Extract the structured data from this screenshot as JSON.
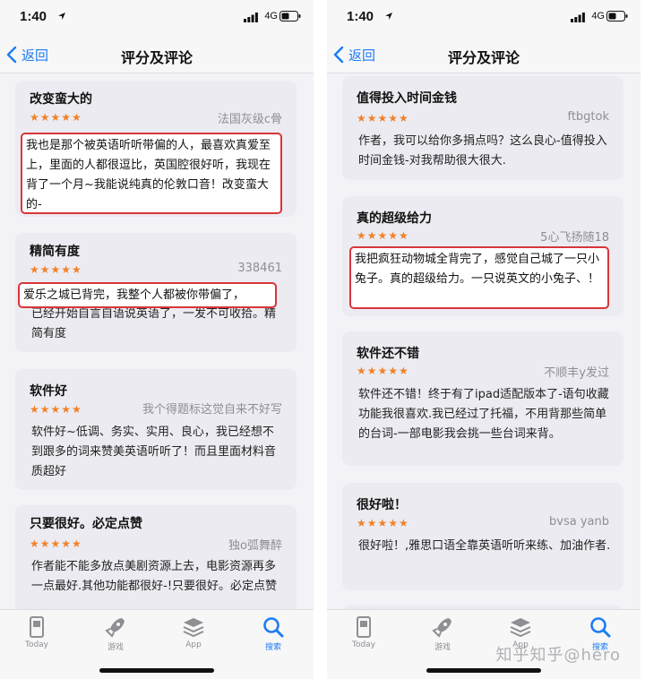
{
  "status": {
    "time": "1:40",
    "network": "4G"
  },
  "nav": {
    "back_label": "返回",
    "title": "评分及评论"
  },
  "tabs": [
    "Today",
    "游戏",
    "App",
    "搜索"
  ],
  "left_reviews": [
    {
      "title": "改变蛮大的",
      "stars": "★★★★★",
      "author": "法国灰级c骨",
      "body": "",
      "highlight": "我也是那个被英语听听带偏的人，最喜欢真爱至上，里面的人都很逗比，英国腔很好听，我现在背了一个月~我能说纯真的伦敦口音！改变蛮大的-"
    },
    {
      "title": "精简有度",
      "stars": "★★★★★",
      "author": "338461",
      "body": "已经开始自言自语说英语了，一发不可收拾。精简有度",
      "highlight": "爱乐之城已背完，我整个人都被你带偏了，"
    },
    {
      "title": "软件好",
      "stars": "★★★★★",
      "author": "我个得题标这觉自来不好写",
      "body": "软件好~低调、务实、实用、良心，我已经想不到跟多的词来赞美英语听听了！而且里面材料音质超好",
      "highlight": ""
    },
    {
      "title": "只要很好。必定点赞",
      "stars": "★★★★★",
      "author": "独o弧舞醉",
      "body": "作者能不能多放点美剧资源上去，电影资源再多一点最好.其他功能都很好-!只要很好。必定点赞",
      "highlight": ""
    }
  ],
  "right_reviews": [
    {
      "title": "值得投入时间金钱",
      "stars": "★★★★★",
      "author": "ftbgtok",
      "body": "作者，我可以给你多捐点吗？这么良心-值得投入时间金钱-对我帮助很大很大.",
      "highlight": ""
    },
    {
      "title": "真的超级给力",
      "stars": "★★★★★",
      "author": "5心飞扬随18",
      "body": "",
      "highlight": "我把疯狂动物城全背完了，感觉自己城了一只小兔子。真的超级给力。一只说英文的小兔子、！"
    },
    {
      "title": "软件还不错",
      "stars": "★★★★★",
      "author": "不顺丰y发过",
      "body": "软件还不错！终于有了ipad适配版本了-语句收藏功能我很喜欢.我已经过了托福，不用背那些简单的台词-一部电影我会挑一些台词来背。",
      "highlight": ""
    },
    {
      "title": "很好啦！",
      "stars": "★★★★★",
      "author": "bvsa yanb",
      "body": "很好啦！,雅思口语全靠英语听听来练、加油作者.",
      "highlight": ""
    }
  ],
  "watermark": "知乎知乎@hero",
  "colors": {
    "accent": "#1c7cf3",
    "star": "#f0822a",
    "highlight_border": "#d8363a",
    "card_bg": "#ecebf1"
  }
}
